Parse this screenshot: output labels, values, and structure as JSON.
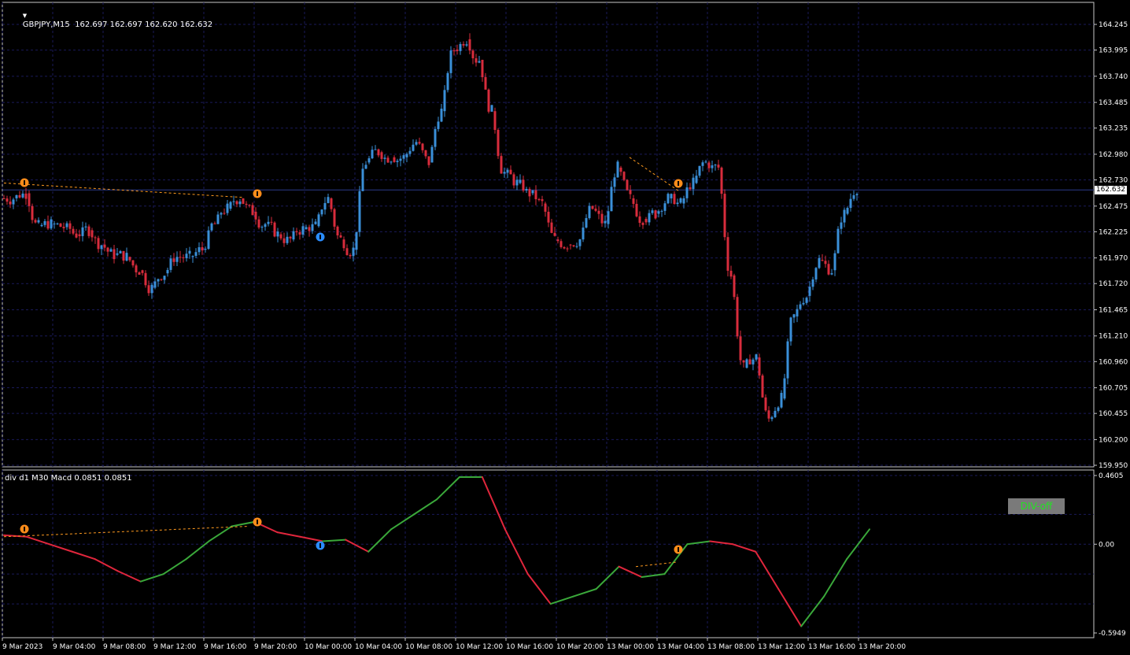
{
  "header": {
    "symbol_line": "GBPJPY,M15  162.697 162.697 162.620 162.632",
    "indicator_line": "div d1 M30 Macd 0.0851 0.0851"
  },
  "price_axis": {
    "current_price": "162.632",
    "ticks": [
      "164.245",
      "163.995",
      "163.740",
      "163.485",
      "163.235",
      "162.980",
      "162.730",
      "162.475",
      "162.225",
      "161.970",
      "161.720",
      "161.465",
      "161.210",
      "160.960",
      "160.705",
      "160.455",
      "160.200",
      "159.950"
    ]
  },
  "indicator_axis": {
    "ticks": [
      "0.4605",
      "0.00",
      "-0.5949"
    ]
  },
  "time_axis": {
    "labels": [
      "9 Mar 2023",
      "9 Mar 04:00",
      "9 Mar 08:00",
      "9 Mar 12:00",
      "9 Mar 16:00",
      "9 Mar 20:00",
      "10 Mar 00:00",
      "10 Mar 04:00",
      "10 Mar 08:00",
      "10 Mar 12:00",
      "10 Mar 16:00",
      "10 Mar 20:00",
      "13 Mar 00:00",
      "13 Mar 04:00",
      "13 Mar 08:00",
      "13 Mar 12:00",
      "13 Mar 16:00",
      "13 Mar 20:00"
    ]
  },
  "button": {
    "div_off": "DIV-off"
  },
  "colors": {
    "background": "#000000",
    "grid": "#1a1a5a",
    "bull": "#3a8fd8",
    "bear": "#d82c3c",
    "macd_up": "#3aa83a",
    "macd_down": "#e0263c",
    "divergence_line": "#ff9a1f",
    "arrow_sell": "#ff8c1a",
    "arrow_buy": "#2a8cff"
  },
  "chart_data": {
    "type": "candlestick",
    "symbol": "GBPJPY",
    "timeframe": "M15",
    "ylim": [
      159.95,
      164.245
    ],
    "close_path": [
      {
        "t": "9 Mar 00:00",
        "price": 162.55
      },
      {
        "t": "9 Mar 01:00",
        "price": 162.6
      },
      {
        "t": "9 Mar 02:00",
        "price": 162.28
      },
      {
        "t": "9 Mar 03:00",
        "price": 162.3
      },
      {
        "t": "9 Mar 04:00",
        "price": 162.27
      },
      {
        "t": "9 Mar 05:00",
        "price": 162.2
      },
      {
        "t": "9 Mar 06:00",
        "price": 162.24
      },
      {
        "t": "9 Mar 07:00",
        "price": 162.1
      },
      {
        "t": "9 Mar 08:00",
        "price": 162.0
      },
      {
        "t": "9 Mar 09:00",
        "price": 161.98
      },
      {
        "t": "9 Mar 10:00",
        "price": 161.85
      },
      {
        "t": "9 Mar 11:00",
        "price": 161.68
      },
      {
        "t": "9 Mar 12:00",
        "price": 161.82
      },
      {
        "t": "9 Mar 13:00",
        "price": 161.98
      },
      {
        "t": "9 Mar 14:00",
        "price": 161.98
      },
      {
        "t": "9 Mar 15:00",
        "price": 162.05
      },
      {
        "t": "9 Mar 16:00",
        "price": 162.3
      },
      {
        "t": "9 Mar 17:00",
        "price": 162.45
      },
      {
        "t": "9 Mar 18:00",
        "price": 162.55
      },
      {
        "t": "9 Mar 19:00",
        "price": 162.42
      },
      {
        "t": "9 Mar 20:00",
        "price": 162.3
      },
      {
        "t": "9 Mar 21:00",
        "price": 162.2
      },
      {
        "t": "9 Mar 22:00",
        "price": 162.15
      },
      {
        "t": "9 Mar 23:00",
        "price": 162.25
      },
      {
        "t": "10 Mar 00:00",
        "price": 162.28
      },
      {
        "t": "10 Mar 01:00",
        "price": 162.55
      },
      {
        "t": "10 Mar 02:00",
        "price": 162.15
      },
      {
        "t": "10 Mar 03:00",
        "price": 162.05
      },
      {
        "t": "10 Mar 04:00",
        "price": 162.9
      },
      {
        "t": "10 Mar 05:00",
        "price": 163.0
      },
      {
        "t": "10 Mar 06:00",
        "price": 162.95
      },
      {
        "t": "10 Mar 07:00",
        "price": 162.95
      },
      {
        "t": "10 Mar 08:00",
        "price": 163.1
      },
      {
        "t": "10 Mar 09:00",
        "price": 162.9
      },
      {
        "t": "10 Mar 10:00",
        "price": 163.4
      },
      {
        "t": "10 Mar 11:00",
        "price": 164.0
      },
      {
        "t": "10 Mar 12:00",
        "price": 164.1
      },
      {
        "t": "10 Mar 13:00",
        "price": 163.9
      },
      {
        "t": "10 Mar 14:00",
        "price": 163.4
      },
      {
        "t": "10 Mar 15:00",
        "price": 162.8
      },
      {
        "t": "10 Mar 16:00",
        "price": 162.7
      },
      {
        "t": "10 Mar 17:00",
        "price": 162.6
      },
      {
        "t": "10 Mar 18:00",
        "price": 162.5
      },
      {
        "t": "10 Mar 19:00",
        "price": 162.15
      },
      {
        "t": "10 Mar 20:00",
        "price": 162.1
      },
      {
        "t": "10 Mar 21:00",
        "price": 162.15
      },
      {
        "t": "10 Mar 22:00",
        "price": 162.45
      },
      {
        "t": "10 Mar 23:00",
        "price": 162.3
      },
      {
        "t": "13 Mar 00:00",
        "price": 162.85
      },
      {
        "t": "13 Mar 01:00",
        "price": 162.55
      },
      {
        "t": "13 Mar 02:00",
        "price": 162.35
      },
      {
        "t": "13 Mar 03:00",
        "price": 162.4
      },
      {
        "t": "13 Mar 04:00",
        "price": 162.55
      },
      {
        "t": "13 Mar 05:00",
        "price": 162.5
      },
      {
        "t": "13 Mar 06:00",
        "price": 162.7
      },
      {
        "t": "13 Mar 07:00",
        "price": 162.9
      },
      {
        "t": "13 Mar 08:00",
        "price": 162.85
      },
      {
        "t": "13 Mar 09:00",
        "price": 161.8
      },
      {
        "t": "13 Mar 10:00",
        "price": 160.9
      },
      {
        "t": "13 Mar 11:00",
        "price": 161.0
      },
      {
        "t": "13 Mar 12:00",
        "price": 160.4
      },
      {
        "t": "13 Mar 13:00",
        "price": 160.6
      },
      {
        "t": "13 Mar 14:00",
        "price": 161.4
      },
      {
        "t": "13 Mar 15:00",
        "price": 161.6
      },
      {
        "t": "13 Mar 16:00",
        "price": 161.95
      },
      {
        "t": "13 Mar 17:00",
        "price": 161.85
      },
      {
        "t": "13 Mar 18:00",
        "price": 162.4
      },
      {
        "t": "13 Mar 19:00",
        "price": 162.65
      }
    ],
    "indicator": {
      "name": "div d1 M30 Macd",
      "ylim": [
        -0.5949,
        0.4605
      ],
      "values": [
        0.06,
        0.05,
        0.0,
        -0.05,
        -0.1,
        -0.18,
        -0.25,
        -0.2,
        -0.1,
        0.02,
        0.12,
        0.15,
        0.08,
        0.05,
        0.02,
        0.03,
        -0.05,
        0.1,
        0.2,
        0.3,
        0.45,
        0.45,
        0.1,
        -0.2,
        -0.4,
        -0.35,
        -0.3,
        -0.15,
        -0.22,
        -0.2,
        0.0,
        0.02,
        0.0,
        -0.05,
        -0.3,
        -0.55,
        -0.35,
        -0.1,
        0.1
      ]
    }
  }
}
